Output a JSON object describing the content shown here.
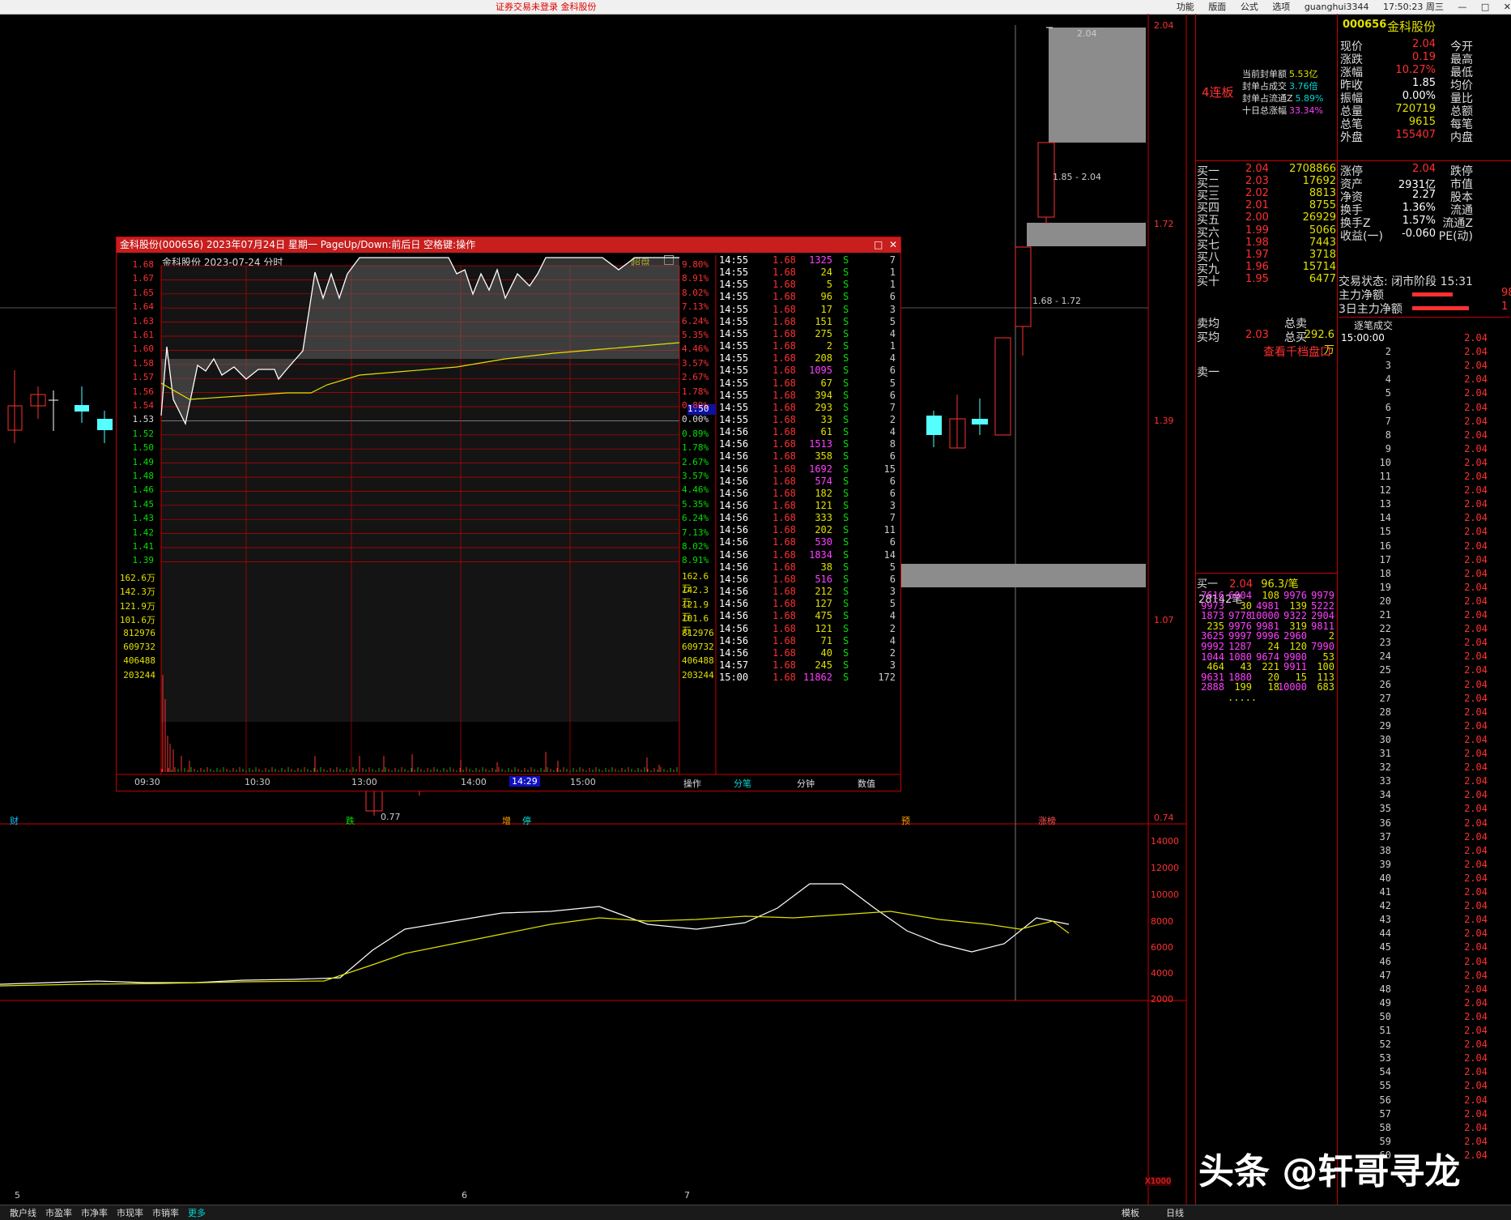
{
  "topbar": {
    "title": "证券交易未登录   金科股份",
    "menu": [
      "功能",
      "版面",
      "公式",
      "选项"
    ],
    "user": "guanghui3344",
    "time": "17:50:23 周三"
  },
  "kchart": {
    "price_labels": [
      "2.04",
      "1.72",
      "1.39",
      "1.07",
      "0.74"
    ],
    "annot_top": "2.04",
    "annot_mid": "1.85 - 2.04",
    "annot_low": "1.68 - 1.72",
    "annot_min": "0.77",
    "events": [
      "财",
      "跌",
      "增",
      "停",
      "预",
      "涨榜"
    ],
    "vol_labels": [
      "14000",
      "12000",
      "10000",
      "8000",
      "6000",
      "4000",
      "2000"
    ],
    "vol_unit": "X1000",
    "date_labels": [
      "5",
      "6",
      "7"
    ],
    "period": "日线"
  },
  "popup": {
    "title": "金科股份(000656) 2023年07月24日 星期一 PageUp/Down:前后日 空格键:操作",
    "chart_title": "金科股份  2023-07-24 分时",
    "tag": "超盘",
    "prices_left": [
      "1.68",
      "1.67",
      "1.65",
      "1.64",
      "1.63",
      "1.61",
      "1.60",
      "1.58",
      "1.57",
      "1.56",
      "1.54",
      "1.53",
      "1.52",
      "1.50",
      "1.49",
      "1.48",
      "1.46",
      "1.45",
      "1.43",
      "1.42",
      "1.41",
      "1.39"
    ],
    "pct_right": [
      "9.80%",
      "8.91%",
      "8.02%",
      "7.13%",
      "6.24%",
      "5.35%",
      "4.46%",
      "3.57%",
      "2.67%",
      "1.78%",
      "0.89%",
      "0.00%",
      "0.89%",
      "1.78%",
      "2.67%",
      "3.57%",
      "4.46%",
      "5.35%",
      "6.24%",
      "7.13%",
      "8.02%",
      "8.91%"
    ],
    "vol_left": [
      "162.6万",
      "142.3万",
      "121.9万",
      "101.6万",
      "812976",
      "609732",
      "406488",
      "203244"
    ],
    "cursor_price": "1.50",
    "time_labels": [
      "09:30",
      "10:30",
      "13:00",
      "14:00",
      "14:29",
      "15:00"
    ],
    "bottom_tabs": [
      "操作",
      "分笔",
      "分钟",
      "数值"
    ],
    "trades": [
      [
        "14:55",
        "1.68",
        "1325",
        "S",
        "7"
      ],
      [
        "14:55",
        "1.68",
        "24",
        "S",
        "1"
      ],
      [
        "14:55",
        "1.68",
        "5",
        "S",
        "1"
      ],
      [
        "14:55",
        "1.68",
        "96",
        "S",
        "6"
      ],
      [
        "14:55",
        "1.68",
        "17",
        "S",
        "3"
      ],
      [
        "14:55",
        "1.68",
        "151",
        "S",
        "5"
      ],
      [
        "14:55",
        "1.68",
        "275",
        "S",
        "4"
      ],
      [
        "14:55",
        "1.68",
        "2",
        "S",
        "1"
      ],
      [
        "14:55",
        "1.68",
        "208",
        "S",
        "4"
      ],
      [
        "14:55",
        "1.68",
        "1095",
        "S",
        "6"
      ],
      [
        "14:55",
        "1.68",
        "67",
        "S",
        "5"
      ],
      [
        "14:55",
        "1.68",
        "394",
        "S",
        "6"
      ],
      [
        "14:55",
        "1.68",
        "293",
        "S",
        "7"
      ],
      [
        "14:55",
        "1.68",
        "33",
        "S",
        "2"
      ],
      [
        "14:56",
        "1.68",
        "61",
        "S",
        "4"
      ],
      [
        "14:56",
        "1.68",
        "1513",
        "S",
        "8"
      ],
      [
        "14:56",
        "1.68",
        "358",
        "S",
        "6"
      ],
      [
        "14:56",
        "1.68",
        "1692",
        "S",
        "15"
      ],
      [
        "14:56",
        "1.68",
        "574",
        "S",
        "6"
      ],
      [
        "14:56",
        "1.68",
        "182",
        "S",
        "6"
      ],
      [
        "14:56",
        "1.68",
        "121",
        "S",
        "3"
      ],
      [
        "14:56",
        "1.68",
        "333",
        "S",
        "7"
      ],
      [
        "14:56",
        "1.68",
        "202",
        "S",
        "11"
      ],
      [
        "14:56",
        "1.68",
        "530",
        "S",
        "6"
      ],
      [
        "14:56",
        "1.68",
        "1834",
        "S",
        "14"
      ],
      [
        "14:56",
        "1.68",
        "38",
        "S",
        "5"
      ],
      [
        "14:56",
        "1.68",
        "516",
        "S",
        "6"
      ],
      [
        "14:56",
        "1.68",
        "212",
        "S",
        "3"
      ],
      [
        "14:56",
        "1.68",
        "127",
        "S",
        "5"
      ],
      [
        "14:56",
        "1.68",
        "475",
        "S",
        "4"
      ],
      [
        "14:56",
        "1.68",
        "121",
        "S",
        "2"
      ],
      [
        "14:56",
        "1.68",
        "71",
        "S",
        "4"
      ],
      [
        "14:56",
        "1.68",
        "40",
        "S",
        "2"
      ],
      [
        "14:57",
        "1.68",
        "245",
        "S",
        "3"
      ],
      [
        "15:00",
        "1.68",
        "11862",
        "S",
        "172"
      ]
    ]
  },
  "rp": {
    "code": "000656",
    "name": "金科股份",
    "limit_tag": "4连板",
    "seal_info": [
      [
        "当前封单额",
        "5.53亿"
      ],
      [
        "封单占成交",
        "3.76倍"
      ],
      [
        "封单占流通Z",
        "5.89%"
      ],
      [
        "十日总涨幅",
        "33.34%"
      ]
    ],
    "quote": [
      [
        "现价",
        "2.04",
        "今开"
      ],
      [
        "涨跌",
        "0.19",
        "最高"
      ],
      [
        "涨幅",
        "10.27%",
        "最低"
      ],
      [
        "昨收",
        "1.85",
        "均价"
      ],
      [
        "振幅",
        "0.00%",
        "量比"
      ],
      [
        "总量",
        "720719",
        "总额"
      ],
      [
        "总笔",
        "9615",
        "每笔"
      ],
      [
        "外盘",
        "155407",
        "内盘"
      ]
    ],
    "bids": [
      [
        "买一",
        "2.04",
        "2708866"
      ],
      [
        "买二",
        "2.03",
        "17692"
      ],
      [
        "买三",
        "2.02",
        "8813"
      ],
      [
        "买四",
        "2.01",
        "8755"
      ],
      [
        "买五",
        "2.00",
        "26929"
      ],
      [
        "买六",
        "1.99",
        "5066"
      ],
      [
        "买七",
        "1.98",
        "7443"
      ],
      [
        "买八",
        "1.97",
        "3718"
      ],
      [
        "买九",
        "1.96",
        "15714"
      ],
      [
        "买十",
        "1.95",
        "6477"
      ]
    ],
    "stats": [
      [
        "涨停",
        "2.04",
        "跌停"
      ],
      [
        "资产",
        "2931亿",
        "市值"
      ],
      [
        "净资",
        "2.27",
        "股本"
      ],
      [
        "换手",
        "1.36%",
        "流通"
      ],
      [
        "换手Z",
        "1.57%",
        "流通Z"
      ],
      [
        "收益(一)",
        "-0.060",
        "PE(动)"
      ]
    ],
    "trade_status": "交易状态: 闭市阶段 15:31",
    "main_net": "主力净额",
    "main_net_val": "98",
    "main_net3": "3日主力净额",
    "main_net3_val": "1",
    "avg_sell": "卖均",
    "avg_buy": "买均",
    "avg_buy_val": "2.03",
    "total_sell": "总卖",
    "total_buy": "总买",
    "total_buy_val": "292.6万",
    "view_1000": "查看千档盘口",
    "sell1": "卖一",
    "zhubi_title": "逐笔成交",
    "zhubi_first": "15:00:00",
    "zhubi_price": "2.04",
    "queue_header": [
      "买一",
      "2.04",
      "96.3/笔",
      "28142笔"
    ],
    "queue": [
      [
        "7616",
        "6004",
        "108",
        "9976",
        "9979"
      ],
      [
        "9973",
        "30",
        "4981",
        "139",
        "5222"
      ],
      [
        "1873",
        "9778",
        "10000",
        "9322",
        "2904"
      ],
      [
        "235",
        "9976",
        "9981",
        "319",
        "9811"
      ],
      [
        "3625",
        "9997",
        "9996",
        "2960",
        "2"
      ],
      [
        "9992",
        "1287",
        "24",
        "120",
        "7990"
      ],
      [
        "1044",
        "1080",
        "9674",
        "9900",
        "53"
      ],
      [
        "464",
        "43",
        "221",
        "9911",
        "100"
      ],
      [
        "9631",
        "1880",
        "20",
        "15",
        "113"
      ],
      [
        "2888",
        "199",
        "18",
        "10000",
        "683"
      ]
    ],
    "queue_more": "....."
  },
  "bottombar": {
    "tabs": [
      "散户线",
      "市盈率",
      "市净率",
      "市现率",
      "市销率",
      "更多"
    ],
    "right": [
      "模板",
      "日线"
    ]
  },
  "watermark": "头条 @轩哥寻龙"
}
